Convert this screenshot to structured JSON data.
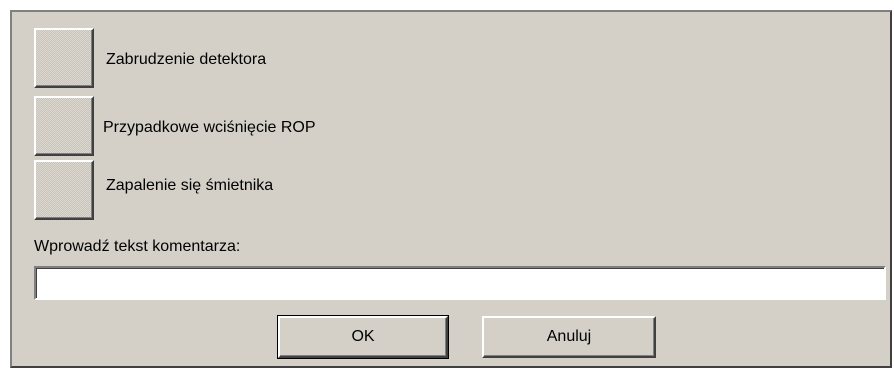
{
  "dialog": {
    "reasons": [
      {
        "label": "Zabrudzenie detektora"
      },
      {
        "label": "Przypadkowe wciśnięcie ROP"
      },
      {
        "label": "Zapalenie się śmietnika"
      }
    ],
    "comment": {
      "label": "Wprowadź tekst komentarza:",
      "value": "",
      "placeholder": ""
    },
    "buttons": {
      "ok_label": "OK",
      "cancel_label": "Anuluj"
    }
  },
  "colors": {
    "dialog_background": "#d4d0c8",
    "input_background": "#ffffff",
    "text": "#000000"
  }
}
